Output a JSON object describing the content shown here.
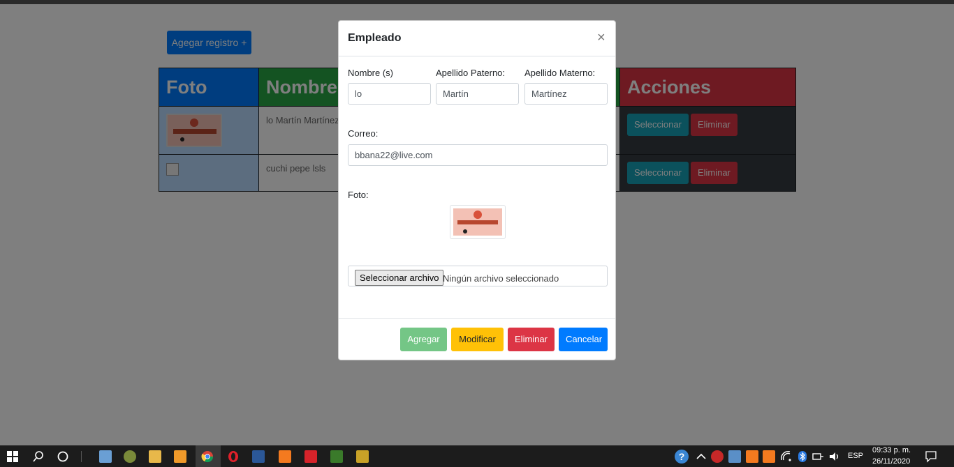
{
  "page": {
    "add_button": "Agegar registro +",
    "table": {
      "headers": [
        "Foto",
        "Nombre",
        "Acciones"
      ],
      "rows": [
        {
          "nombre": "lo Martín Martínez",
          "select_label": "Seleccionar",
          "delete_label": "Eliminar"
        },
        {
          "nombre": "cuchi pepe lsls",
          "select_label": "Seleccionar",
          "delete_label": "Eliminar"
        }
      ]
    }
  },
  "modal": {
    "title": "Empleado",
    "close_symbol": "×",
    "fields": {
      "nombre_label": "Nombre (s)",
      "nombre_value": "lo",
      "ap_paterno_label": "Apellido Paterno:",
      "ap_paterno_value": "Martín",
      "ap_materno_label": "Apellido Materno:",
      "ap_materno_value": "Martínez",
      "correo_label": "Correo:",
      "correo_value": "bbana22@live.com",
      "foto_label": "Foto:",
      "file_button": "Seleccionar archivo",
      "file_status": "Ningún archivo seleccionado"
    },
    "footer": {
      "agregar": "Agregar",
      "modificar": "Modificar",
      "eliminar": "Eliminar",
      "cancelar": "Cancelar"
    }
  },
  "taskbar": {
    "language": "ESP",
    "time": "09:33 p. m.",
    "date": "26/11/2020"
  },
  "colors": {
    "primary": "#007bff",
    "success": "#28a745",
    "danger": "#dc3545",
    "warning": "#ffc107",
    "info": "#17a2b8",
    "dark": "#343a40"
  }
}
